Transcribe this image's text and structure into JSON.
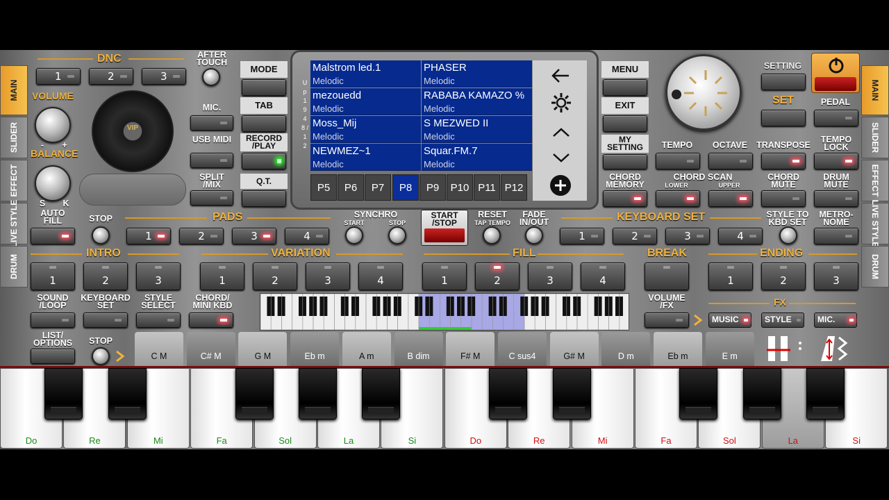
{
  "side_tabs_left": [
    "MAIN",
    "SLIDER",
    "EFFECT",
    "LIVE STYLE",
    "DRUM"
  ],
  "side_tabs_right": [
    "MAIN",
    "SLIDER",
    "EFFECT",
    "LIVE STYLE",
    "DRUM"
  ],
  "dnc": {
    "title": "DNC",
    "buttons": [
      "1",
      "2",
      "3"
    ],
    "after_touch": "AFTER TOUCH"
  },
  "volume": "VOLUME",
  "balance": "BALANCE",
  "vol_min": "-",
  "vol_max": "+",
  "bal_s": "S",
  "bal_k": "K",
  "disc_label": "VIP",
  "mic_label": "MIC.",
  "usb_midi": "USB MIDI",
  "split_mix": "SPLIT /MIX",
  "mode": "MODE",
  "tab": "TAB",
  "record_play": "RECORD /PLAY",
  "qt": "Q.T.",
  "menu": "MENU",
  "exit": "EXIT",
  "my_setting": "MY SETTING",
  "chord_memory": "CHORD MEMORY",
  "screen": {
    "side_letters": "U p 1 9 4 8 / 1 2",
    "rows": [
      [
        {
          "name": "Malstrom led.1",
          "type": "Melodic"
        },
        {
          "name": "PHASER",
          "type": "Melodic"
        }
      ],
      [
        {
          "name": "mezouedd",
          "type": "Melodic"
        },
        {
          "name": "RABABA KAMAZO %",
          "type": "Melodic"
        }
      ],
      [
        {
          "name": "Moss_Mij",
          "type": "Melodic"
        },
        {
          "name": "S MEZWED II",
          "type": "Melodic"
        }
      ],
      [
        {
          "name": "NEWMEZ~1",
          "type": "Melodic"
        },
        {
          "name": "Squar.FM.7",
          "type": "Melodic"
        }
      ]
    ],
    "pages": [
      "P5",
      "P6",
      "P7",
      "P8",
      "P9",
      "P10",
      "P11",
      "P12"
    ],
    "selected_page": "P8"
  },
  "setting": "SETTING",
  "set": "SET",
  "pedal": "PEDAL",
  "tempo": "TEMPO",
  "octave": "OCTAVE",
  "transpose": "TRANSPOSE",
  "tempo_lock": "TEMPO LOCK",
  "chord_scan": "CHORD SCAN",
  "lower": "LOWER",
  "upper": "UPPER",
  "chord_mute": "CHORD MUTE",
  "drum_mute": "DRUM MUTE",
  "auto_fill": "AUTO FILL",
  "stop": "STOP",
  "pads": {
    "title": "PADS",
    "buttons": [
      "1",
      "2",
      "3",
      "4"
    ]
  },
  "synchro": "SYNCHRO",
  "sync_start": "START",
  "sync_stop": "STOP",
  "start_stop": "START /STOP",
  "reset": "RESET",
  "tap_tempo": "TAP TEMPO",
  "fade": "FADE IN/OUT",
  "keyboard_set": {
    "title": "KEYBOARD SET",
    "buttons": [
      "1",
      "2",
      "3",
      "4"
    ]
  },
  "style_to_kbd": "STYLE TO KBD SET",
  "metronome": "METRO- NOME",
  "intro": {
    "title": "INTRO",
    "buttons": [
      "1",
      "2",
      "3"
    ]
  },
  "variation": {
    "title": "VARIATION",
    "buttons": [
      "1",
      "2",
      "3",
      "4"
    ]
  },
  "fill": {
    "title": "FILL",
    "buttons": [
      "1",
      "2",
      "3",
      "4"
    ]
  },
  "break": "BREAK",
  "ending": {
    "title": "ENDING",
    "buttons": [
      "1",
      "2",
      "3"
    ]
  },
  "sound_loop": "SOUND /LOOP",
  "keyboard_set_lbl": "KEYBOARD SET",
  "style_select": "STYLE SELECT",
  "chord_mini": "CHORD/ MINI KBD",
  "volume_fx": "VOLUME /FX",
  "fx": {
    "title": "FX",
    "buttons": [
      "MUSIC",
      "STYLE",
      "MIC."
    ]
  },
  "list_options": "LIST/ OPTIONS",
  "stop2": "STOP",
  "chords": [
    "C M",
    "C# M",
    "G M",
    "Eb m",
    "A m",
    "B dim",
    "F# M",
    "C sus4",
    "G# M",
    "D m",
    "Eb m",
    "E m"
  ],
  "white_keys": [
    {
      "label": "Do",
      "color": "#1a8a1a"
    },
    {
      "label": "Re",
      "color": "#1a8a1a"
    },
    {
      "label": "Mi",
      "color": "#1a8a1a"
    },
    {
      "label": "Fa",
      "color": "#1a8a1a"
    },
    {
      "label": "Sol",
      "color": "#1a8a1a"
    },
    {
      "label": "La",
      "color": "#1a8a1a"
    },
    {
      "label": "Si",
      "color": "#1a8a1a"
    },
    {
      "label": "Do",
      "color": "#d01010"
    },
    {
      "label": "Re",
      "color": "#d01010"
    },
    {
      "label": "Mi",
      "color": "#d01010"
    },
    {
      "label": "Fa",
      "color": "#d01010"
    },
    {
      "label": "Sol",
      "color": "#d01010"
    },
    {
      "label": "La",
      "color": "#d01010"
    },
    {
      "label": "Si",
      "color": "#d01010"
    }
  ],
  "pressed_key": "La"
}
